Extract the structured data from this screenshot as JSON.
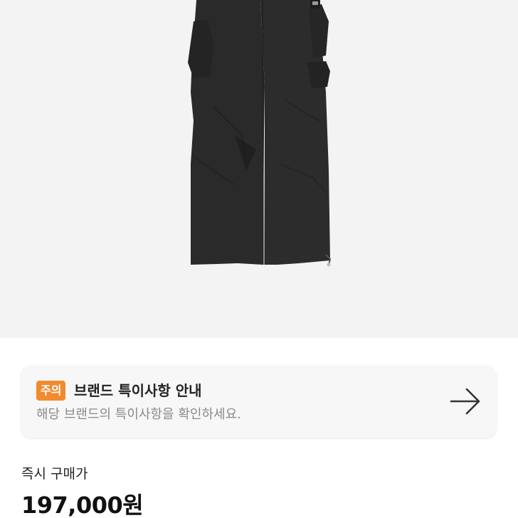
{
  "product": {
    "image_icon": "cargo-pants-image",
    "background_color": "#f3f3f3"
  },
  "notice": {
    "badge": "주의",
    "badge_color": "#f28a2e",
    "title": "브랜드 특이사항 안내",
    "subtitle": "해당 브랜드의 특이사항을 확인하세요.",
    "arrow_icon": "arrow-right-icon"
  },
  "price": {
    "label": "즉시 구매가",
    "value": "197,000원"
  }
}
